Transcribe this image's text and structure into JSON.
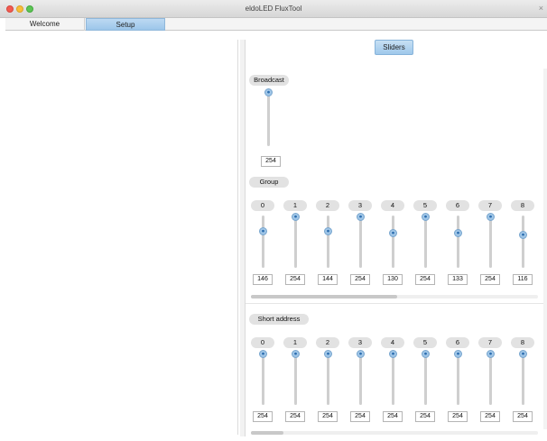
{
  "window": {
    "title": "eldoLED FluxTool"
  },
  "tabs": [
    {
      "label": "Welcome",
      "selected": false
    },
    {
      "label": "Setup",
      "selected": true
    }
  ],
  "toolbar": {
    "sliders_label": "Sliders"
  },
  "broadcast": {
    "label": "Broadcast",
    "value": "254"
  },
  "group": {
    "label": "Group",
    "channels": [
      {
        "id": "0",
        "value": "146",
        "level": 146
      },
      {
        "id": "1",
        "value": "254",
        "level": 254
      },
      {
        "id": "2",
        "value": "144",
        "level": 144
      },
      {
        "id": "3",
        "value": "254",
        "level": 254
      },
      {
        "id": "4",
        "value": "130",
        "level": 130
      },
      {
        "id": "5",
        "value": "254",
        "level": 254
      },
      {
        "id": "6",
        "value": "133",
        "level": 133
      },
      {
        "id": "7",
        "value": "254",
        "level": 254
      },
      {
        "id": "8",
        "value": "116",
        "level": 116
      }
    ]
  },
  "short_address": {
    "label": "Short address",
    "channels": [
      {
        "id": "0",
        "value": "254",
        "level": 254
      },
      {
        "id": "1",
        "value": "254",
        "level": 254
      },
      {
        "id": "2",
        "value": "254",
        "level": 254
      },
      {
        "id": "3",
        "value": "254",
        "level": 254
      },
      {
        "id": "4",
        "value": "254",
        "level": 254
      },
      {
        "id": "5",
        "value": "254",
        "level": 254
      },
      {
        "id": "6",
        "value": "254",
        "level": 254
      },
      {
        "id": "7",
        "value": "254",
        "level": 254
      },
      {
        "id": "8",
        "value": "254",
        "level": 254
      }
    ]
  },
  "slider_max": 254
}
